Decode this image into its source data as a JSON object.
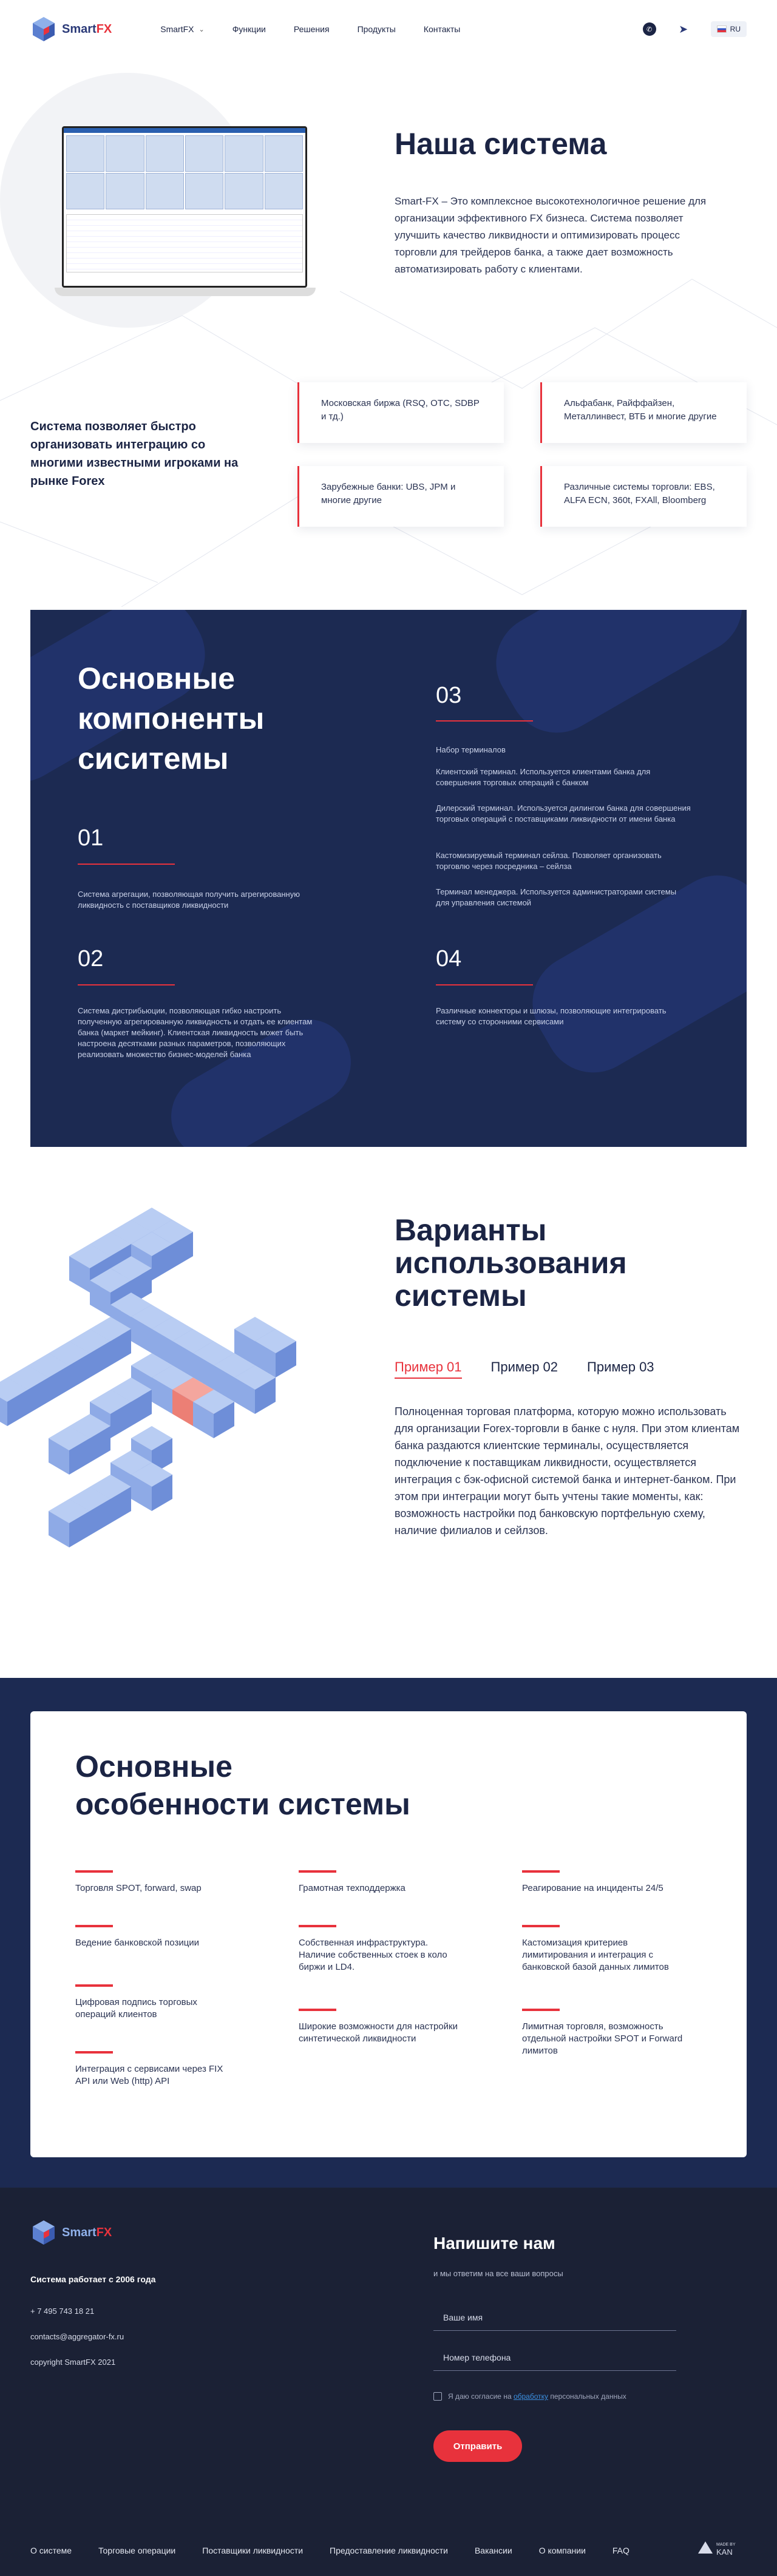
{
  "header": {
    "logo_text_a": "Smart",
    "logo_text_b": "FX",
    "nav": [
      "SmartFX",
      "Функции",
      "Решения",
      "Продукты",
      "Контакты"
    ],
    "lang": "RU",
    "icons": [
      "whatsapp-icon",
      "telegram-icon"
    ]
  },
  "hero": {
    "title": "Наша система",
    "text": "Smart-FX – Это комплексное высокотехнологичное решение для организации эффективного FX бизнеса. Система позволяет улучшить качество ликвидности и оптимизировать процесс торговли для трейдеров банка, а также дает возможность автоматизировать работу с клиентами."
  },
  "integration": {
    "text": "Система позволяет быстро организовать интеграцию со многими известными игроками на рынке Forex",
    "cards": [
      "Московская биржа (RSQ, OTC, SDBP и тд.)",
      "Альфабанк, Райффайзен, Металлинвест, ВТБ и многие другие",
      "Зарубежные банки: UBS, JPM и многие другие",
      "Различные системы торговли: EBS, ALFA ECN, 360t, FXAll, Bloomberg"
    ]
  },
  "components": {
    "title_lines": [
      "Основные",
      "компоненты",
      "сиситемы"
    ],
    "items": [
      {
        "num": "01",
        "text": "Система агрегации, позволяющая получить агрегированную ликвидность с поставщиков ликвидности"
      },
      {
        "num": "02",
        "text": "Система дистрибьюции, позволяющая гибко настроить полученную агрегированную ликвидность и отдать ее клиентам банка (маркет мейкинг). Клиентская ликвидность может быть настроена десятками разных параметров, позволяющих реализовать множество бизнес-моделей банка"
      },
      {
        "num": "03",
        "intro": "Набор терминалов",
        "bullets": [
          "Клиентский терминал. Используется клиентами банка для совершения торговых операций с банком",
          "Дилерский терминал. Используется дилингом банка для совершения торговых операций с поставщиками ликвидности от имени банка",
          "Кастомизируемый терминал сейлза. Позволяет организовать торговлю через посредника – сейлза",
          "Терминал менеджера. Используется администраторами системы для управления системой"
        ]
      },
      {
        "num": "04",
        "text": "Различные коннекторы и шлюзы, позволяющие интегрировать систему со сторонними сервисами"
      }
    ]
  },
  "usage": {
    "title_lines": [
      "Варианты",
      "использования",
      "системы"
    ],
    "tabs": [
      "Пример 01",
      "Пример 02",
      "Пример 03"
    ],
    "active_tab": 0,
    "text": "Полноценная торговая платформа, которую можно использовать для организации Forex-торговли в банке с нуля. При этом клиентам банка раздаются клиентские терминалы, осуществляется подключение к поставщикам ликвидности, осуществляется интеграция с бэк-офисной системой банка и интернет-банком. При этом при интеграции могут быть учтены такие моменты, как: возможность настройки под банковскую портфельную схему, наличие филиалов и сейлзов."
  },
  "features": {
    "title_lines": [
      "Основные",
      "особенности системы"
    ],
    "columns": [
      [
        "Торговля SPOT, forward, swap",
        "Ведение банковской позиции",
        "Цифровая подпись торговых операций клиентов",
        "Интеграция с сервисами через FIX API или Web (http) API"
      ],
      [
        "Грамотная техподдержка",
        "Собственная инфраструктура. Наличие собственных стоек в коло биржи и LD4.",
        "Широкие возможности для настройки синтетической ликвидности"
      ],
      [
        "Реагирование на инциденты 24/5",
        "Кастомизация критериев лимитирования и интеграция с банковской базой данных лимитов",
        "Лимитная торговля, возможность отдельной настройки SPOT и Forward лимитов"
      ]
    ]
  },
  "footer": {
    "since": "Система работает с 2006 года",
    "phone": "+ 7 495 743 18 21",
    "email": "contacts@aggregator-fx.ru",
    "copyright": "copyright SmartFX 2021",
    "form_title": "Напишите нам",
    "form_sub": "и мы ответим на все ваши вопросы",
    "name_placeholder": "Ваше имя",
    "phone_placeholder": "Номер телефона",
    "consent_a": "Я даю согласие на ",
    "consent_link": "обработку",
    "consent_b": " персональных данных",
    "submit": "Отправить",
    "nav": [
      "О системе",
      "Торговые операции",
      "Поставщики ликвидности",
      "Предоставление ликвидности",
      "Вакансии",
      "О компании",
      "FAQ"
    ],
    "made_by": "MADE BY",
    "made_name": "KAN"
  },
  "colors": {
    "accent": "#e8323c",
    "navy": "#1c2a52",
    "footer": "#1b2135"
  }
}
